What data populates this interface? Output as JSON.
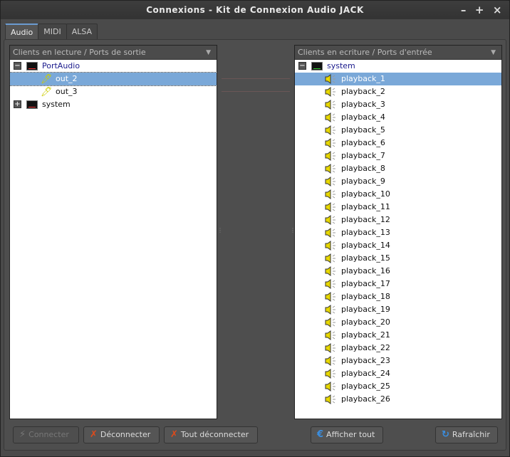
{
  "window": {
    "title": "Connexions - Kit de Connexion Audio JACK"
  },
  "tabs": [
    {
      "label": "Audio",
      "active": true
    },
    {
      "label": "MIDI"
    },
    {
      "label": "ALSA"
    }
  ],
  "left_panel": {
    "header": "Clients en lecture / Ports de sortie",
    "clients": [
      {
        "name": "PortAudio",
        "expanded": true,
        "ports": [
          {
            "name": "out_2",
            "selected": true
          },
          {
            "name": "out_3"
          }
        ]
      },
      {
        "name": "system",
        "expanded": false,
        "ports": []
      }
    ]
  },
  "right_panel": {
    "header": "Clients en ecriture / Ports d'entrée",
    "clients": [
      {
        "name": "system",
        "expanded": true,
        "ports": [
          "playback_1",
          "playback_2",
          "playback_3",
          "playback_4",
          "playback_5",
          "playback_6",
          "playback_7",
          "playback_8",
          "playback_9",
          "playback_10",
          "playback_11",
          "playback_12",
          "playback_13",
          "playback_14",
          "playback_15",
          "playback_16",
          "playback_17",
          "playback_18",
          "playback_19",
          "playback_20",
          "playback_21",
          "playback_22",
          "playback_23",
          "playback_24",
          "playback_25",
          "playback_26"
        ],
        "selected": "playback_1"
      }
    ]
  },
  "buttons": {
    "connect": "Connecter",
    "disconnect": "Déconnecter",
    "disconnect_all": "Tout déconnecter",
    "expand_all": "Afficher tout",
    "refresh": "Rafraîchir"
  }
}
